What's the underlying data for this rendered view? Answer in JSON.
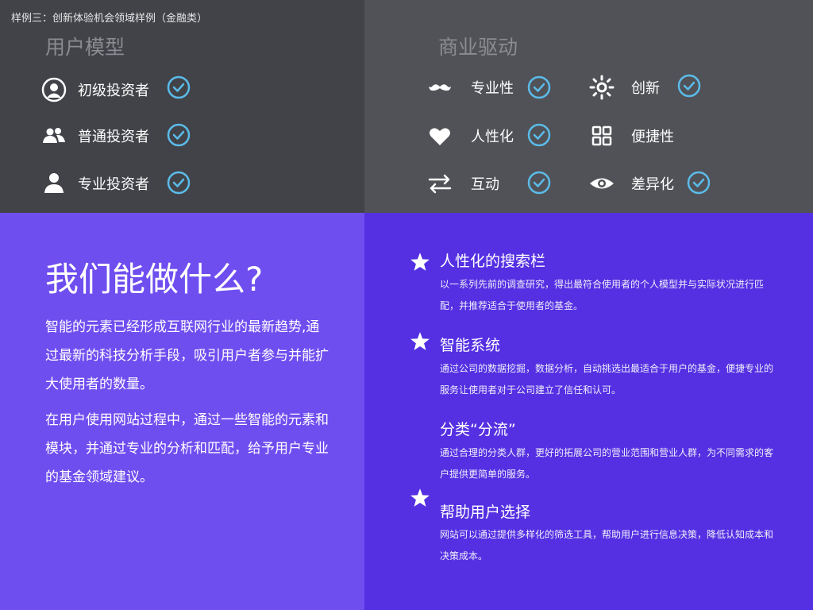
{
  "caption": "样例三：创新体验机会领域样例（金融类）",
  "user_model": {
    "title": "用户模型",
    "items": [
      {
        "label": "初级投资者",
        "icon": "user-circle-icon"
      },
      {
        "label": "普通投资者",
        "icon": "users-icon"
      },
      {
        "label": "专业投资者",
        "icon": "user-icon"
      }
    ]
  },
  "business": {
    "title": "商业驱动",
    "items": [
      {
        "label": "专业性",
        "icon": "mustache-icon"
      },
      {
        "label": "创新",
        "icon": "sun-icon"
      },
      {
        "label": "人性化",
        "icon": "heart-icon"
      },
      {
        "label": "便捷性",
        "icon": "grid-icon"
      },
      {
        "label": "互动",
        "icon": "swap-arrows-icon"
      },
      {
        "label": "差异化",
        "icon": "eye-icon"
      }
    ]
  },
  "what": {
    "title": "我们能做什么?",
    "paragraphs": [
      "智能的元素已经形成互联网行业的最新趋势,通过最新的科技分析手段，吸引用户者参与并能扩大使用者的数量。",
      "在用户使用网站过程中，通过一些智能的元素和模块，并通过专业的分析和匹配，给予用户专业的基金领域建议。"
    ]
  },
  "features": [
    {
      "title": "人性化的搜索栏",
      "desc": "以一系列先前的调查研究，得出最符合使用者的个人模型并与实际状况进行匹配，并推荐适合于使用者的基金。",
      "star": true
    },
    {
      "title": "智能系统",
      "desc": "通过公司的数据挖掘，数据分析，自动挑选出最适合于用户的基金，便捷专业的服务让使用者对于公司建立了信任和认可。",
      "star": true
    },
    {
      "title": "分类“分流”",
      "desc": "通过合理的分类人群，更好的拓展公司的营业范围和营业人群，为不同需求的客户提供更简单的服务。",
      "star": false
    },
    {
      "title": "帮助用户选择",
      "desc": "网站可以通过提供多样化的筛选工具，帮助用户进行信息决策，降低认知成本和决策成本。",
      "star": true
    }
  ],
  "colors": {
    "top_left_bg": "#414349",
    "top_right_bg": "#505257",
    "bottom_left_bg": "#6f4ef0",
    "bottom_right_bg": "#5430e2",
    "check": "#5bbbe8"
  }
}
